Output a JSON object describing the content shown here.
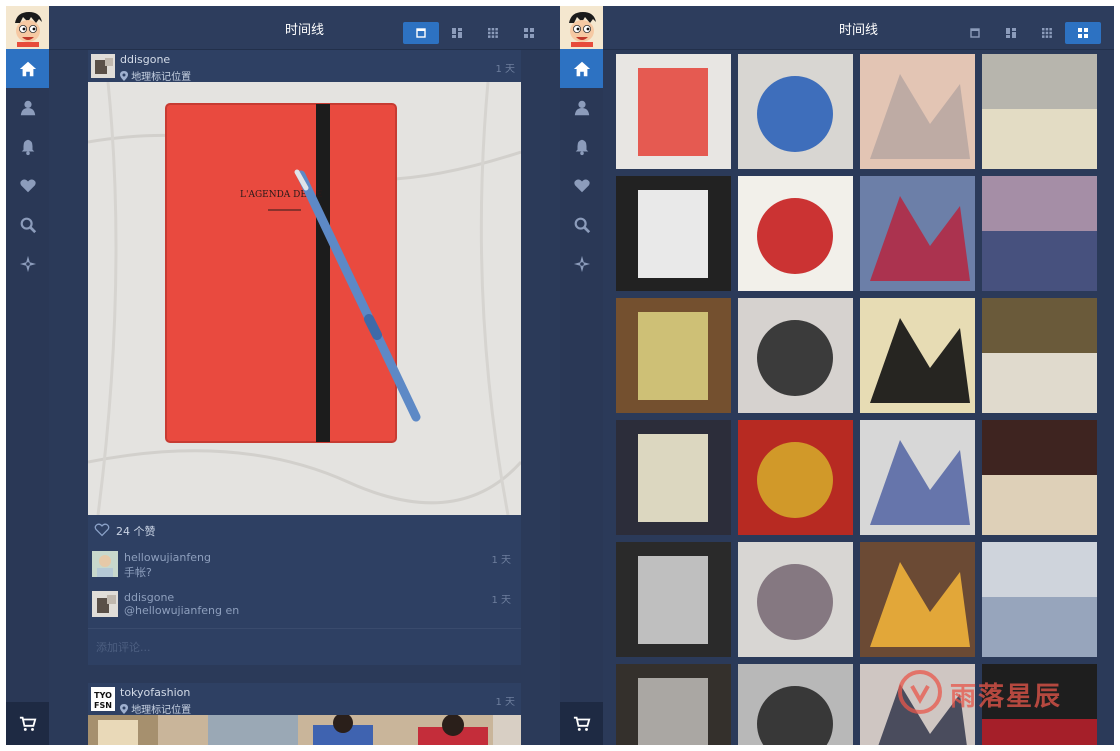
{
  "app": {
    "title": "时间线"
  },
  "sidebar": {
    "items": [
      {
        "name": "home",
        "icon": "home-icon"
      },
      {
        "name": "profile",
        "icon": "person-icon"
      },
      {
        "name": "notifications",
        "icon": "bell-icon"
      },
      {
        "name": "likes",
        "icon": "heart-icon"
      },
      {
        "name": "search",
        "icon": "search-icon"
      },
      {
        "name": "explore",
        "icon": "compass-star-icon"
      }
    ],
    "cart_icon": "cart-icon"
  },
  "left": {
    "active_view": 0,
    "post": {
      "username": "ddisgone",
      "location": "地理标记位置",
      "time": "1 天",
      "photo_text": "L'AGENDA DES É",
      "likes": "24 个赞",
      "comments": [
        {
          "user": "hellowujianfeng",
          "text": "手帐?",
          "time": "1 天"
        },
        {
          "user": "ddisgone",
          "text": "@hellowujianfeng en",
          "time": "1 天"
        }
      ],
      "add_comment_placeholder": "添加评论..."
    },
    "post2": {
      "username": "tokyofashion",
      "location": "地理标记位置",
      "time": "1 天",
      "avatar_text": "TYO FSN"
    }
  },
  "right": {
    "active_view": 3,
    "tiles": [
      {
        "name": "red-notebook",
        "colors": [
          "#e44a40",
          "#e8e6e3"
        ]
      },
      {
        "name": "girls-street-fashion",
        "colors": [
          "#2e63b8",
          "#d8d6d2"
        ]
      },
      {
        "name": "anime-poster",
        "colors": [
          "#b9a7a2",
          "#e3c5b4"
        ]
      },
      {
        "name": "cheese-plate",
        "colors": [
          "#e8e0c7",
          "#b7b5ad"
        ]
      },
      {
        "name": "pig-drawing",
        "colors": [
          "#ffffff",
          "#222222"
        ]
      },
      {
        "name": "cake-slice-red",
        "colors": [
          "#c61e1f",
          "#f2f0ea"
        ]
      },
      {
        "name": "mannequin-red",
        "colors": [
          "#b22b45",
          "#6c7fa8"
        ]
      },
      {
        "name": "mannequin-crown",
        "colors": [
          "#3d4a7a",
          "#a58ea6"
        ]
      },
      {
        "name": "fruit-tarts",
        "colors": [
          "#d8cc7e",
          "#74502f"
        ]
      },
      {
        "name": "girl-selfie",
        "colors": [
          "#2a2a2a",
          "#d6d2cf"
        ]
      },
      {
        "name": "eat-me-sign",
        "colors": [
          "#111111",
          "#e7dcb4"
        ]
      },
      {
        "name": "cheese-jars",
        "colors": [
          "#ede8de",
          "#6a5a3a"
        ]
      },
      {
        "name": "cream-texture",
        "colors": [
          "#efeacf",
          "#2c2d3a"
        ]
      },
      {
        "name": "mustard-bottles",
        "colors": [
          "#d4a52a",
          "#b72a22"
        ]
      },
      {
        "name": "computer-screen",
        "colors": [
          "#5a6aa6",
          "#d7d7d7"
        ]
      },
      {
        "name": "gift-ribbon",
        "colors": [
          "#f0e3c9",
          "#3e2420"
        ]
      },
      {
        "name": "washington-graffiti",
        "colors": [
          "#cfcfcf",
          "#2a2a2a"
        ]
      },
      {
        "name": "fabric-pieces",
        "colors": [
          "#7c6e78",
          "#d8d6d3"
        ]
      },
      {
        "name": "kid-waving",
        "colors": [
          "#f0b13a",
          "#6b4a34"
        ]
      },
      {
        "name": "building-facade",
        "colors": [
          "#90a0b8",
          "#cfd4dc"
        ]
      },
      {
        "name": "dark-sculpture",
        "colors": [
          "#b7b5b0",
          "#34302c"
        ]
      },
      {
        "name": "football-figure",
        "colors": [
          "#2a2a2a",
          "#b8b8b8"
        ]
      },
      {
        "name": "girl-street",
        "colors": [
          "#3b3e52",
          "#cfc6c2"
        ]
      },
      {
        "name": "girl-shop",
        "colors": [
          "#b41f2a",
          "#1e1e1e"
        ]
      }
    ]
  },
  "watermark": {
    "text": "雨落星辰"
  },
  "colors": {
    "accent": "#2d72c2",
    "panel": "#2b3a59",
    "sidebar": "#2a3856"
  }
}
